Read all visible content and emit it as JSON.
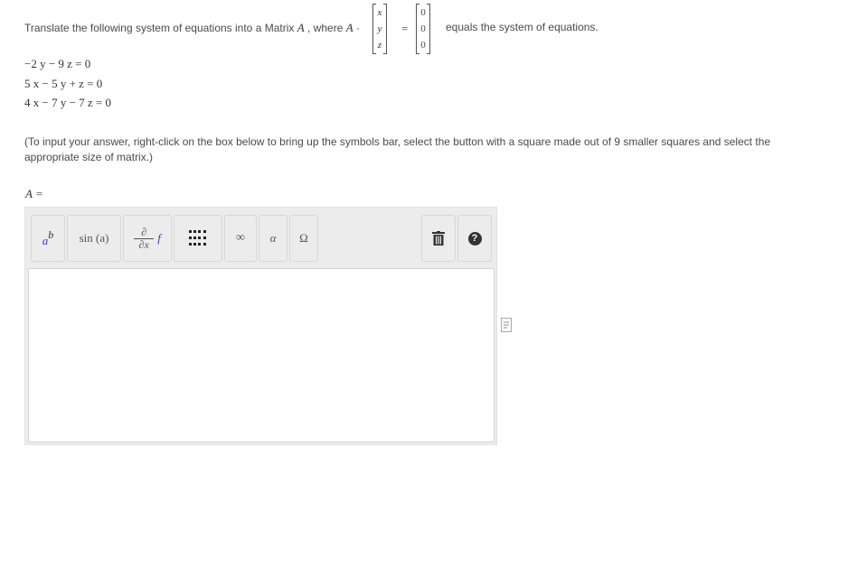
{
  "question": {
    "prompt_before": "Translate the following system of equations into a Matrix",
    "matrix_name": "A",
    "where_text": ", where",
    "dot": "·",
    "vector_entries": [
      "x",
      "y",
      "z"
    ],
    "equals_sign": "=",
    "zero_entries": [
      "0",
      "0",
      "0"
    ],
    "prompt_after": "equals the system of equations.",
    "equations": [
      "−2 y − 9 z = 0",
      "5 x − 5 y + z = 0",
      "4 x − 7 y − 7 z = 0"
    ],
    "instruction": "(To input your answer, right-click on the box below to bring up the symbols bar, select the button with a square made out of 9 smaller squares and select the appropriate size of matrix.)",
    "answer_label": "A ="
  },
  "toolbar": {
    "superscript_base": "a",
    "superscript_exp": "b",
    "sin_label": "sin (a)",
    "partial_top": "∂",
    "partial_bottom": "∂x",
    "partial_f": "f",
    "infinity": "∞",
    "alpha": "α",
    "omega": "Ω",
    "help": "?"
  }
}
